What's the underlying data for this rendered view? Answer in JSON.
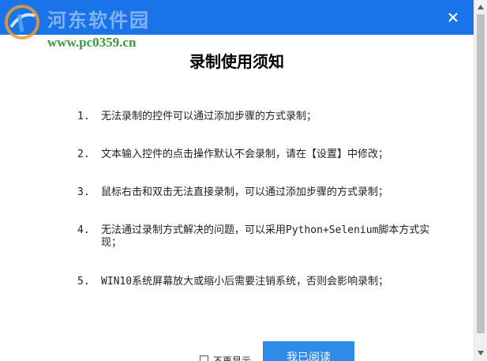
{
  "watermark": {
    "site_name": "河东软件园",
    "url": "www.pc0359.cn"
  },
  "dialog": {
    "title": "录制使用须知",
    "close_glyph": "✕"
  },
  "items": [
    {
      "num": "1.",
      "text": "无法录制的控件可以通过添加步骤的方式录制；"
    },
    {
      "num": "2.",
      "text": "文本输入控件的点击操作默认不会录制，请在【设置】中修改；"
    },
    {
      "num": "3.",
      "text": "鼠标右击和双击无法直接录制，可以通过添加步骤的方式录制；"
    },
    {
      "num": "4.",
      "text": "无法通过录制方式解决的问题，可以采用Python+Selenium脚本方式实现；"
    },
    {
      "num": "5.",
      "text": "WIN10系统屏幕放大或缩小后需要注销系统，否则会影响录制；"
    }
  ],
  "footer": {
    "dont_show_label": "不再显示",
    "read_button_label": "我已阅读"
  },
  "colors": {
    "titlebar": "#1a73e8",
    "button": "#2e8bea",
    "watermark_url": "#3c9a3c"
  }
}
